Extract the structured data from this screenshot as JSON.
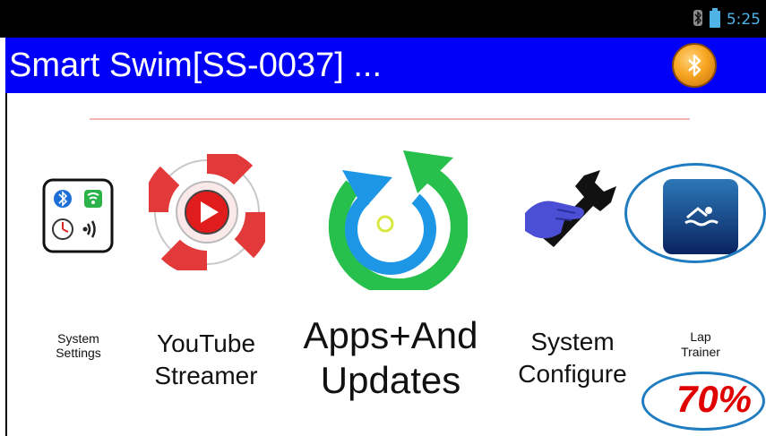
{
  "status_bar": {
    "time": "5:25",
    "icons": [
      "bluetooth-status-icon",
      "battery-icon"
    ]
  },
  "header": {
    "title": "Smart Swim[SS-0037] ...",
    "action_icon": "bluetooth-orange-icon"
  },
  "apps": [
    {
      "label_lines": [
        "System",
        "Settings"
      ],
      "icon": "system-settings-icon"
    },
    {
      "label_lines": [
        "YouTube",
        "Streamer"
      ],
      "icon": "lifebuoy-play-icon"
    },
    {
      "label_lines": [
        "Apps+And",
        "Updates"
      ],
      "icon": "refresh-arrows-icon"
    },
    {
      "label_lines": [
        "System",
        "Configure"
      ],
      "icon": "wrench-hand-icon"
    },
    {
      "label_lines": [
        "Lap",
        "Trainer"
      ],
      "icon": "swimmer-icon"
    }
  ],
  "annotation": {
    "percent": "70%"
  },
  "colors": {
    "title_bar": "#0000f8",
    "divider": "#f2b5b5",
    "annotation_ring": "#1f7cc1",
    "percent_text": "#e00000"
  }
}
